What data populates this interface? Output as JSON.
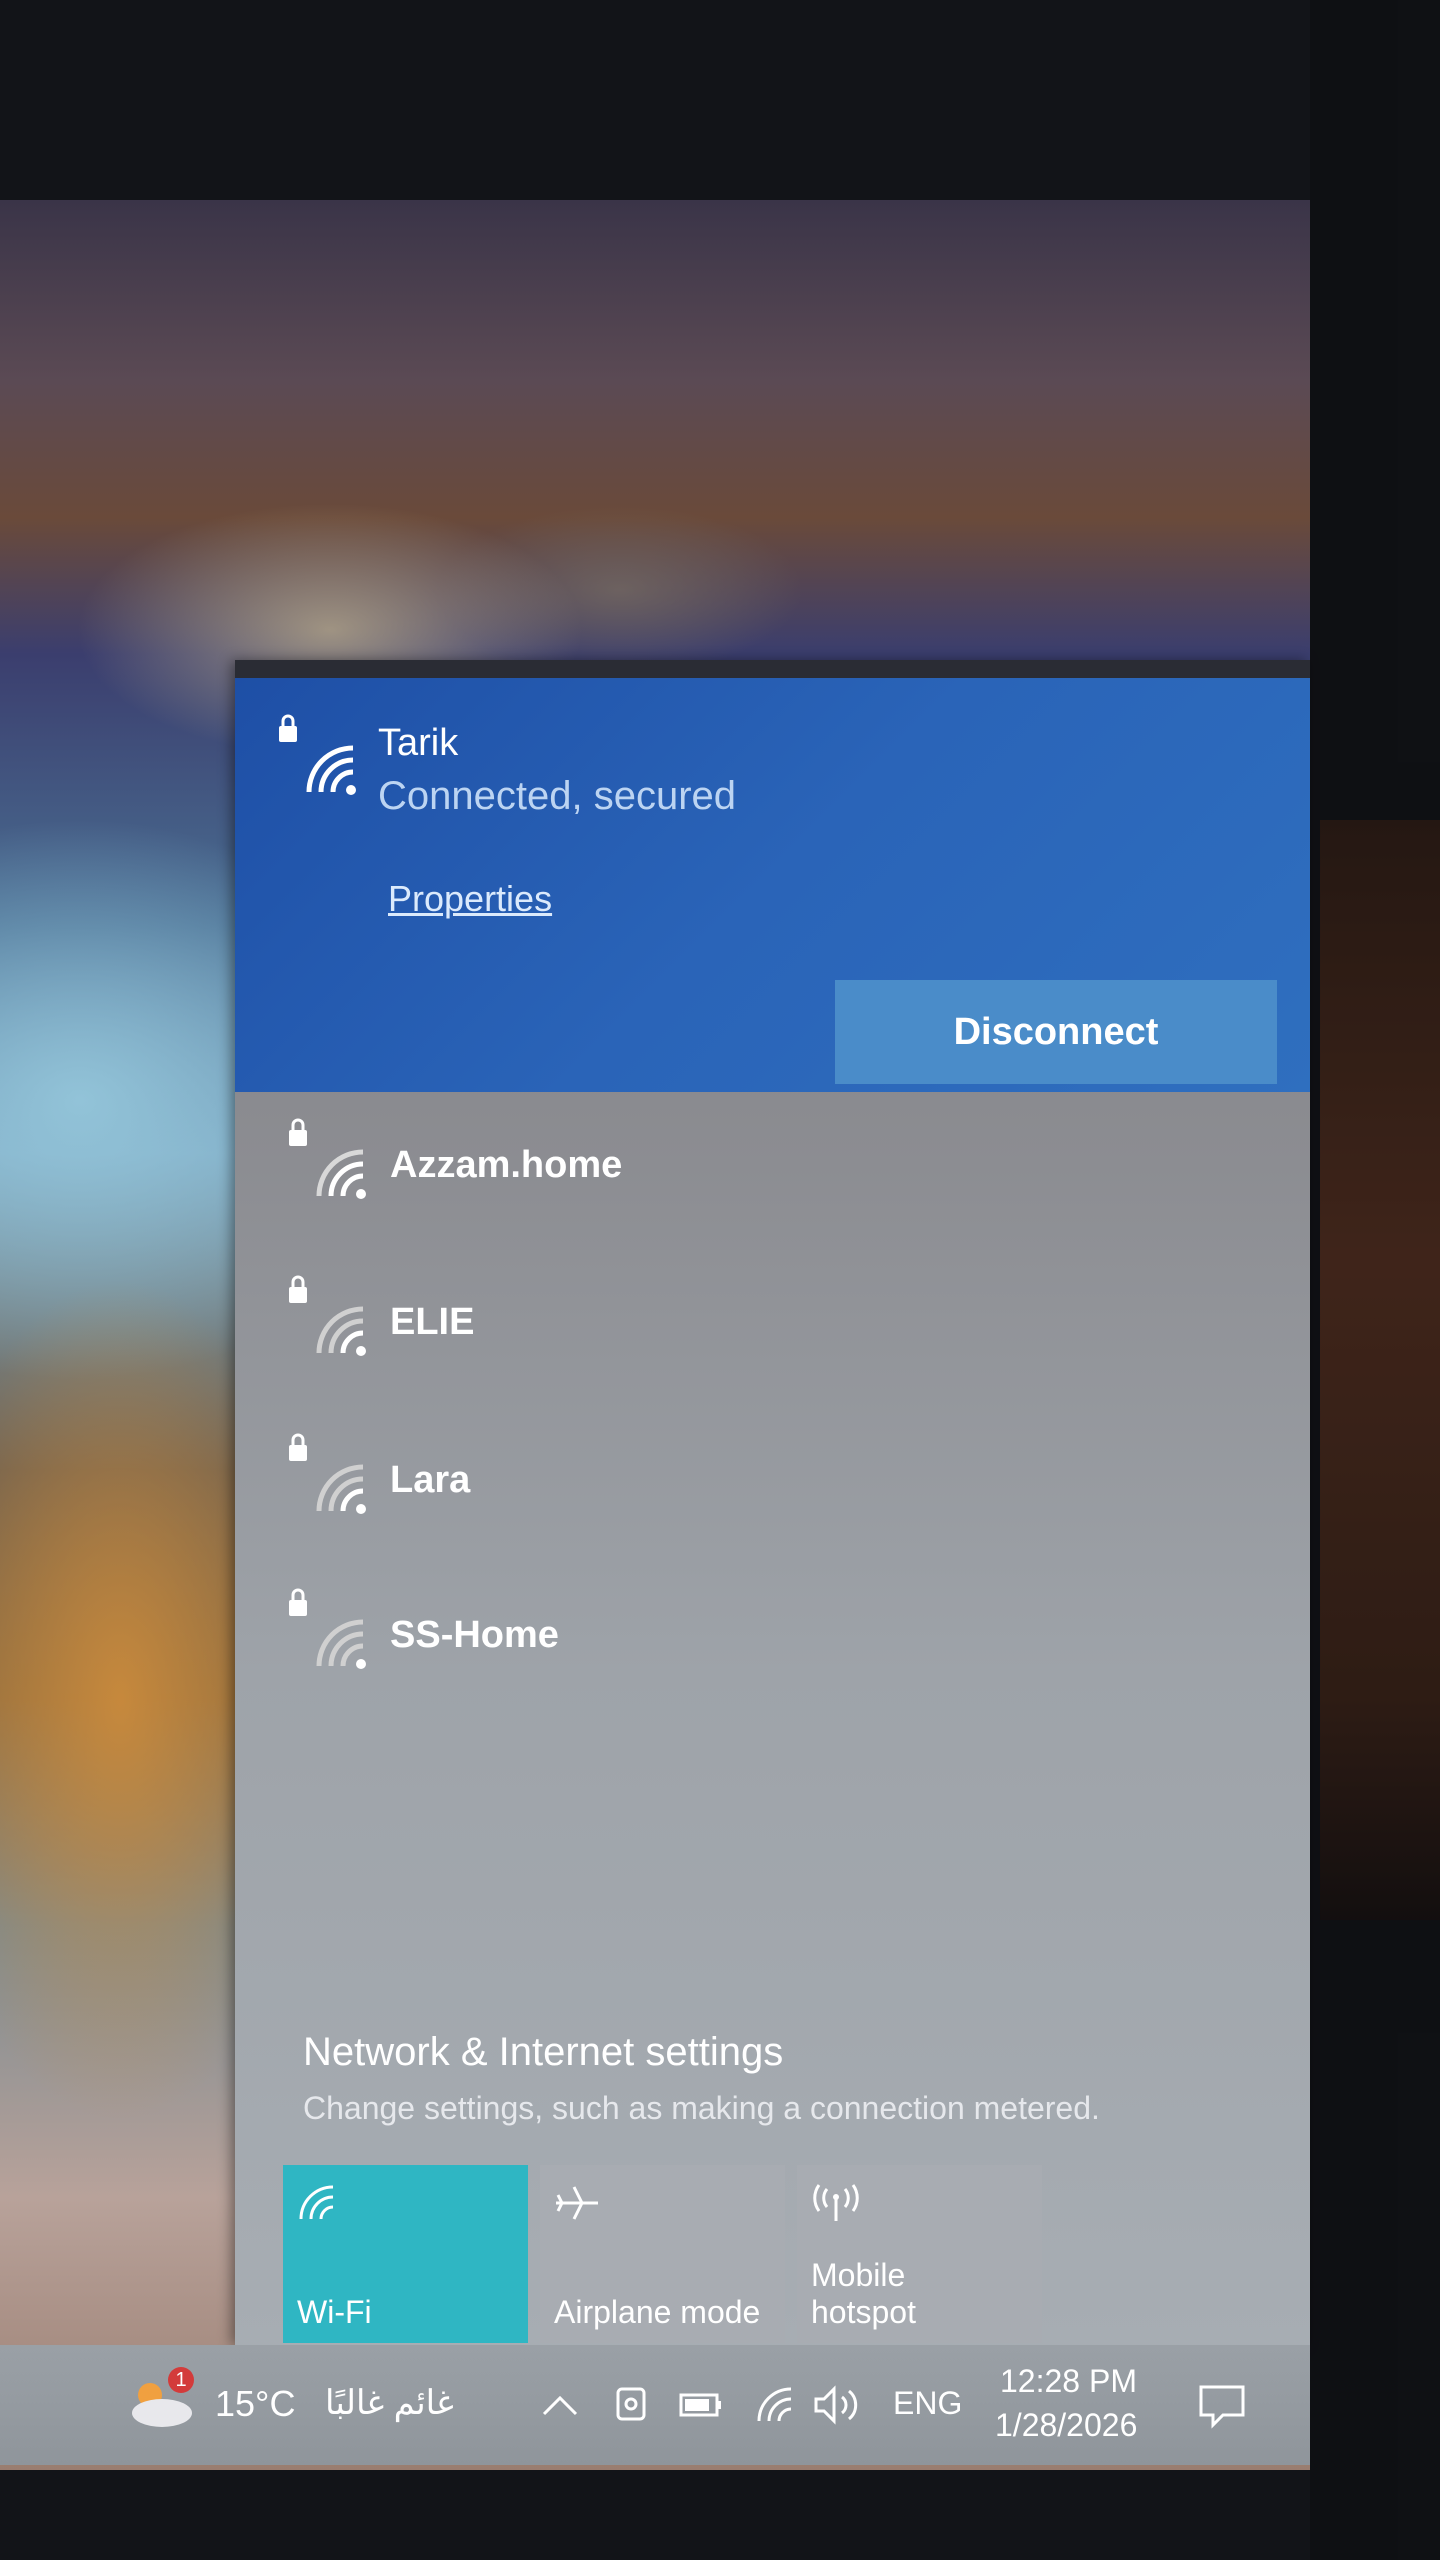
{
  "connected": {
    "name": "Tarik",
    "status": "Connected, secured",
    "properties_label": "Properties",
    "disconnect_label": "Disconnect"
  },
  "networks": [
    {
      "name": "Azzam.home"
    },
    {
      "name": "ELIE"
    },
    {
      "name": "Lara"
    },
    {
      "name": "SS-Home"
    }
  ],
  "settings": {
    "title": "Network & Internet settings",
    "subtitle": "Change settings, such as making a connection metered."
  },
  "tiles": {
    "wifi": "Wi-Fi",
    "airplane": "Airplane mode",
    "hotspot_line1": "Mobile",
    "hotspot_line2": "hotspot"
  },
  "taskbar": {
    "temperature": "15°C",
    "weather": "غائم غالبًا",
    "notification_count": "1",
    "language": "ENG",
    "time": "12:28 PM",
    "date": "1/28/2026"
  },
  "colors": {
    "accent": "#2a64b8",
    "wifi_tile": "#2fb6c3"
  }
}
